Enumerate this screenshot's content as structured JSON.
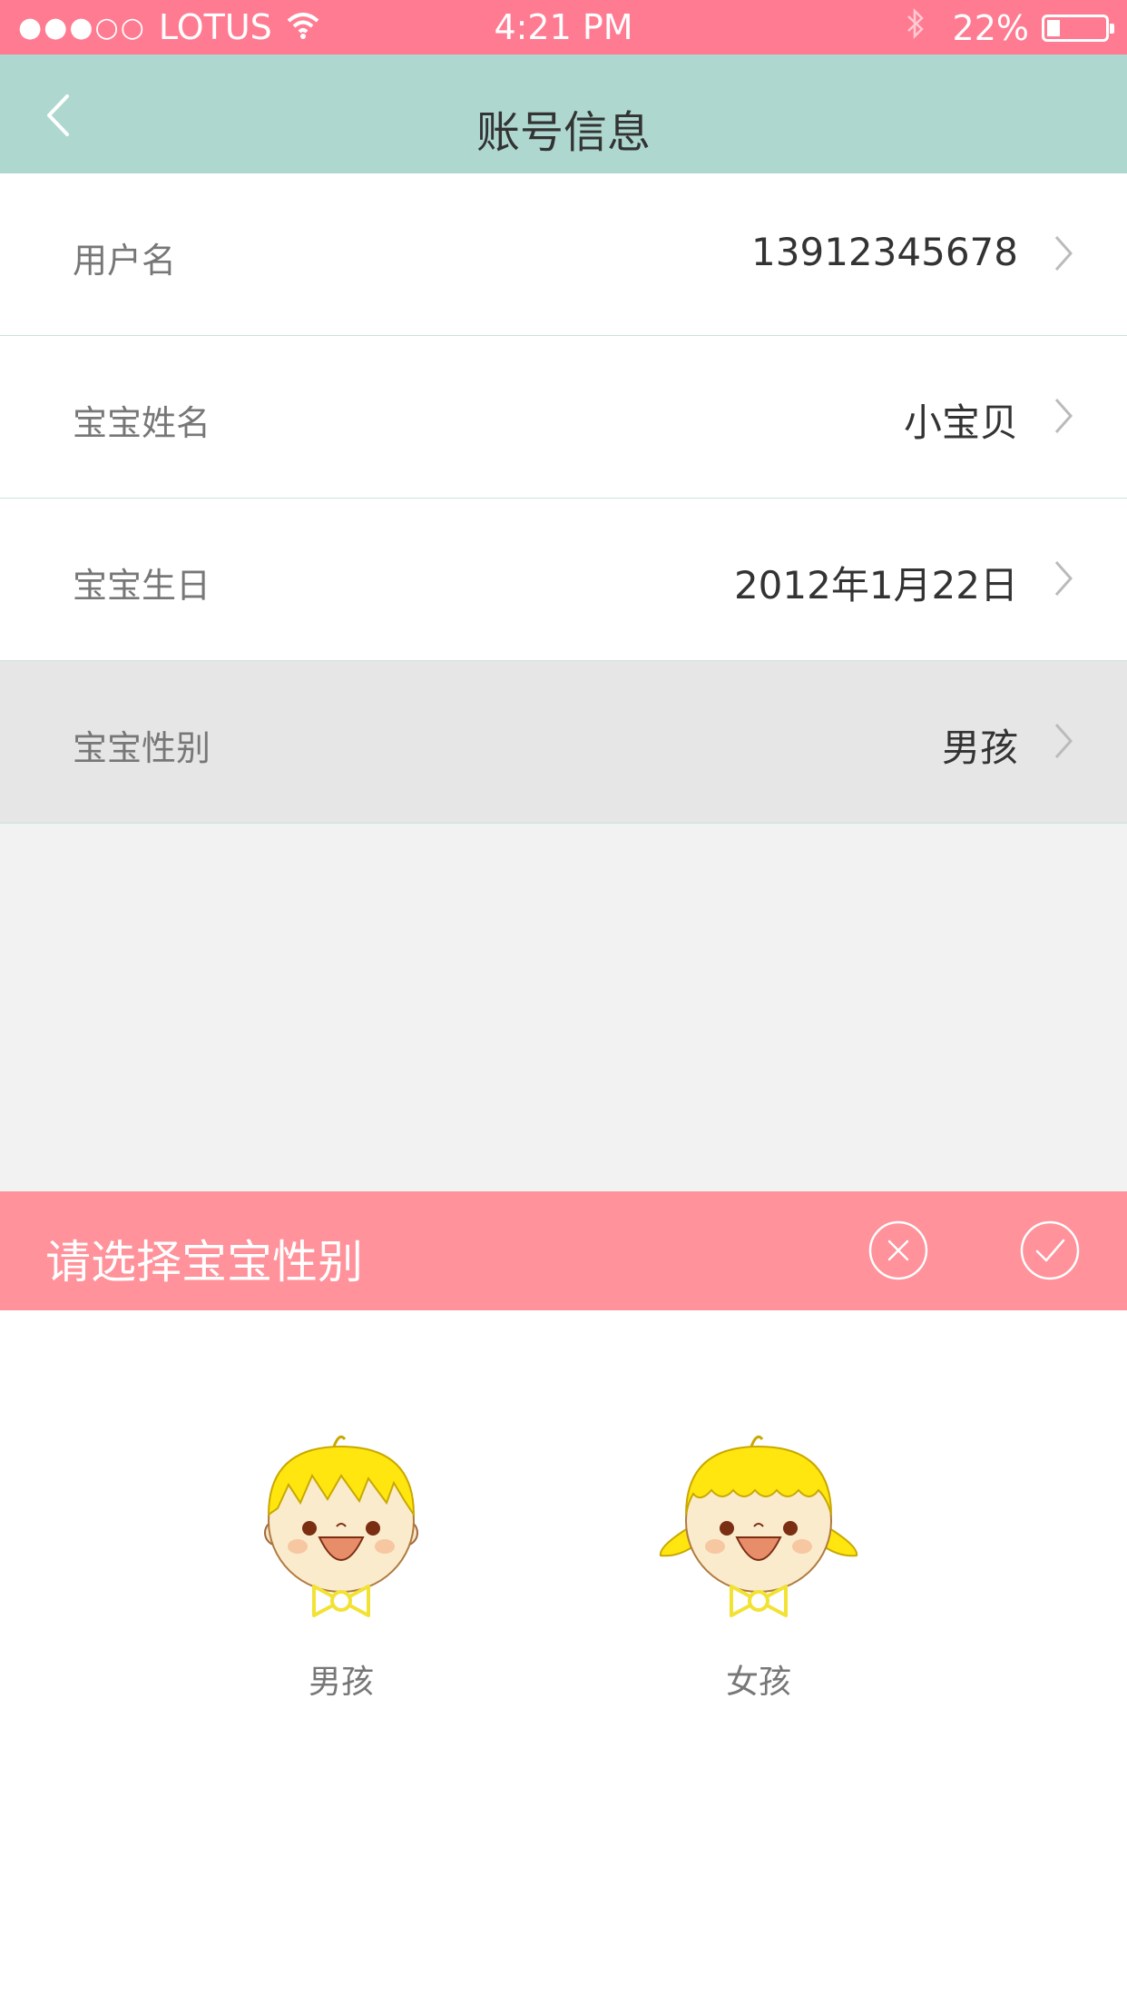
{
  "status_bar": {
    "signal": "●●●○○",
    "carrier": "LOTUS",
    "time": "4:21 PM",
    "battery_percent_label": "22%",
    "battery_level": 0.22
  },
  "nav": {
    "back_icon": "chevron-left-icon",
    "title": "账号信息"
  },
  "rows": [
    {
      "label": "用户名",
      "value": "13912345678"
    },
    {
      "label": "宝宝姓名",
      "value": "小宝贝"
    },
    {
      "label": "宝宝生日",
      "value": "2012年1月22日"
    },
    {
      "label": "宝宝性别",
      "value": "男孩"
    }
  ],
  "sheet": {
    "title": "请选择宝宝性别",
    "cancel_icon": "close-circle-icon",
    "confirm_icon": "check-circle-icon",
    "options": [
      {
        "label": "男孩",
        "icon": "boy-avatar-icon"
      },
      {
        "label": "女孩",
        "icon": "girl-avatar-icon"
      }
    ]
  },
  "colors": {
    "status_bar": "#ff7b91",
    "nav_bar": "#aed8cf",
    "sheet_header": "#ff929a",
    "selected_row": "#e6e6e6"
  }
}
